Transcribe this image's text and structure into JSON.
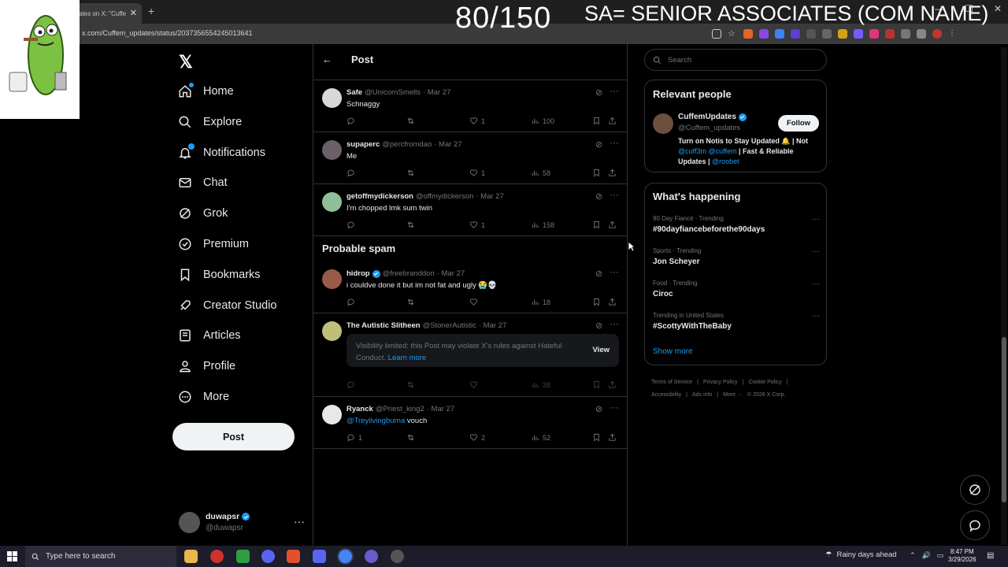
{
  "browser": {
    "tab_title": "ates on X: \"Cuffe",
    "tab_close": "✕",
    "new_tab": "+",
    "url": "x.com/Cuffem_updates/status/2037356554245013641"
  },
  "overlay": {
    "counter": "80/150",
    "title": "SA= SENIOR ASSOCIATES (COM NAME)"
  },
  "nav": {
    "logo": "𝕏",
    "items": [
      {
        "label": "Home",
        "icon": "home-icon"
      },
      {
        "label": "Explore",
        "icon": "search-icon"
      },
      {
        "label": "Notifications",
        "icon": "bell-icon"
      },
      {
        "label": "Chat",
        "icon": "mail-icon"
      },
      {
        "label": "Grok",
        "icon": "grok-icon"
      },
      {
        "label": "Premium",
        "icon": "premium-icon"
      },
      {
        "label": "Bookmarks",
        "icon": "bookmark-icon"
      },
      {
        "label": "Creator Studio",
        "icon": "rocket-icon"
      },
      {
        "label": "Articles",
        "icon": "article-icon"
      },
      {
        "label": "Profile",
        "icon": "person-icon"
      },
      {
        "label": "More",
        "icon": "more-circle-icon"
      }
    ],
    "post_button": "Post",
    "account": {
      "name": "duwapsr",
      "handle": "@duwapsr",
      "dots": "···"
    }
  },
  "center": {
    "back": "←",
    "title": "Post",
    "section_spam": "Probable spam",
    "tweets": [
      {
        "name": "Safe",
        "handle": "@UnicornSmells",
        "date": "· Mar 27",
        "text": "Schnaggy",
        "replies": "",
        "likes": "1",
        "views": "100",
        "avatar_color": "#d8d8d8"
      },
      {
        "name": "supaperc",
        "handle": "@percfromdao",
        "date": "· Mar 27",
        "text": "Me",
        "replies": "",
        "likes": "1",
        "views": "58",
        "avatar_color": "#6a6068"
      },
      {
        "name": "getoffmydickerson",
        "handle": "@offmydickerson",
        "date": "· Mar 27",
        "text": "I'm chopped lmk sum twin",
        "replies": "",
        "likes": "1",
        "views": "158",
        "avatar_color": "#8fbf9a"
      },
      {
        "name": "hidrop",
        "handle": "@freebranddon",
        "date": "· Mar 27",
        "text": "i couldve done it but im not fat and ugly 😭💀",
        "replies": "",
        "likes": "",
        "views": "18",
        "avatar_color": "#9a5a4a",
        "verified": true
      },
      {
        "name": "The Autistic Slitheen",
        "handle": "@StonerAutistic",
        "date": "· Mar 27",
        "text": "",
        "replies": "",
        "likes": "",
        "views": "38",
        "avatar_color": "#bfbf7a"
      },
      {
        "name": "Ryanck",
        "handle": "@Priest_king2",
        "date": "· Mar 27",
        "mention": "@Treylivingburna",
        "text": " vouch",
        "replies": "1",
        "likes": "2",
        "views": "52",
        "avatar_color": "#e8e8e8"
      }
    ],
    "visibility_notice": {
      "text": "Visibility limited: this Post may violate X's rules against Hateful Conduct.",
      "link": "Learn more",
      "view": "View"
    },
    "more_dots": "···"
  },
  "right": {
    "search_placeholder": "Search",
    "relevant_title": "Relevant people",
    "relevant_person": {
      "name": "CuffemUpdates",
      "handle": "@Cuffem_updates",
      "follow": "Follow",
      "bio_a": "Turn on Notis to Stay Updated 🔔 | Not ",
      "bio_m1": "@cuff3m",
      "bio_sp": " ",
      "bio_m2": "@cuffem",
      "bio_b": " | Fast & Reliable Updates | ",
      "bio_m3": "@roobet"
    },
    "happening_title": "What's happening",
    "trends": [
      {
        "meta": "90 Day Fiancé · Trending",
        "name": "#90dayfiancebeforethe90days"
      },
      {
        "meta": "Sports · Trending",
        "name": "Jon Scheyer"
      },
      {
        "meta": "Food · Trending",
        "name": "Ciroc"
      },
      {
        "meta": "Trending in United States",
        "name": "#ScottyWithTheBaby"
      }
    ],
    "trend_dots": "···",
    "show_more": "Show more",
    "footer": [
      "Terms of Service",
      "|",
      "Privacy Policy",
      "|",
      "Cookie Policy",
      "|",
      "Accessibility",
      "|",
      "Ads info",
      "|",
      "More ···",
      "© 2026 X Corp."
    ]
  },
  "taskbar": {
    "search_placeholder": "Type here to search",
    "weather": "Rainy days ahead",
    "time": "8:47 PM",
    "date": "3/29/2026"
  },
  "colors": {
    "accent": "#1d9bf0",
    "background": "#000000",
    "border": "#2f3336",
    "muted": "#71767b"
  }
}
